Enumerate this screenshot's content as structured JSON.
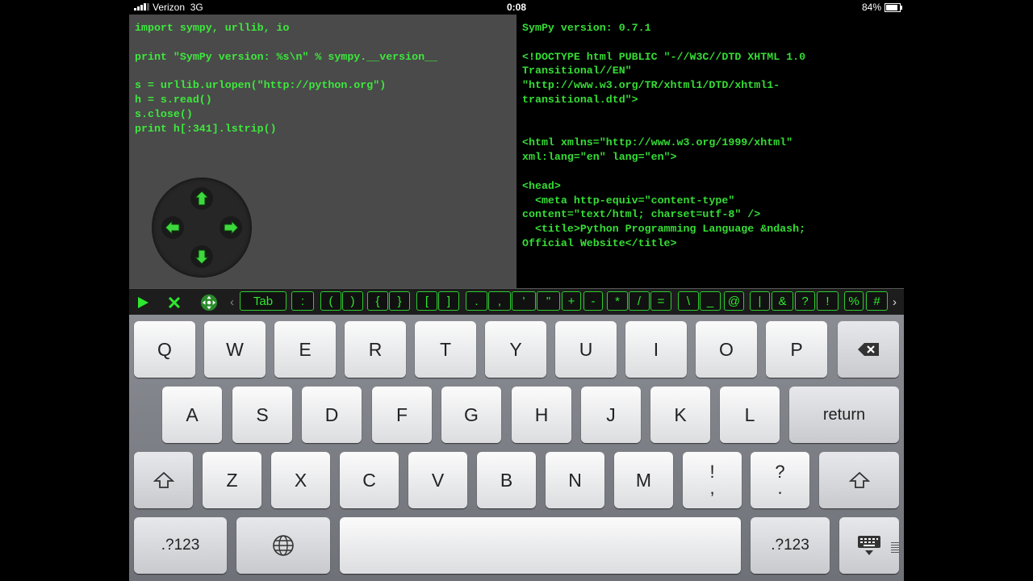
{
  "status": {
    "carrier": "Verizon",
    "network": "3G",
    "time": "0:08",
    "battery": "84%",
    "battery_level": 0.84
  },
  "editor": {
    "code": "import sympy, urllib, io\n\nprint \"SymPy version: %s\\n\" % sympy.__version__\n\ns = urllib.urlopen(\"http://python.org\")\nh = s.read()\ns.close()\nprint h[:341].lstrip()"
  },
  "output": {
    "text": "SymPy version: 0.7.1\n\n<!DOCTYPE html PUBLIC \"-//W3C//DTD XHTML 1.0\nTransitional//EN\"\n\"http://www.w3.org/TR/xhtml1/DTD/xhtml1-\ntransitional.dtd\">\n\n\n<html xmlns=\"http://www.w3.org/1999/xhtml\"\nxml:lang=\"en\" lang=\"en\">\n\n<head>\n  <meta http-equiv=\"content-type\"\ncontent=\"text/html; charset=utf-8\" />\n  <title>Python Programming Language &ndash;\nOfficial Website</title>"
  },
  "toolbar": {
    "keys": [
      "Tab",
      ":",
      "(",
      ")",
      "{",
      "}",
      "[",
      "]",
      ".",
      ",",
      "'",
      "\"",
      "+",
      "-",
      "*",
      "/",
      "=",
      "\\",
      "_",
      "@",
      "|",
      "&",
      "?",
      "!",
      "%",
      "#"
    ]
  },
  "keyboard": {
    "row1": [
      "Q",
      "W",
      "E",
      "R",
      "T",
      "Y",
      "U",
      "I",
      "O",
      "P"
    ],
    "row2": [
      "A",
      "S",
      "D",
      "F",
      "G",
      "H",
      "J",
      "K",
      "L"
    ],
    "row3": [
      "Z",
      "X",
      "C",
      "V",
      "B",
      "N",
      "M"
    ],
    "return_label": "return",
    "numbers_label": ".?123",
    "punct1": [
      "!",
      ","
    ],
    "punct2": [
      "?",
      "."
    ]
  },
  "colors": {
    "code_green": "#3de83d",
    "editor_bg": "#4a4a4a",
    "output_bg": "#000000"
  }
}
